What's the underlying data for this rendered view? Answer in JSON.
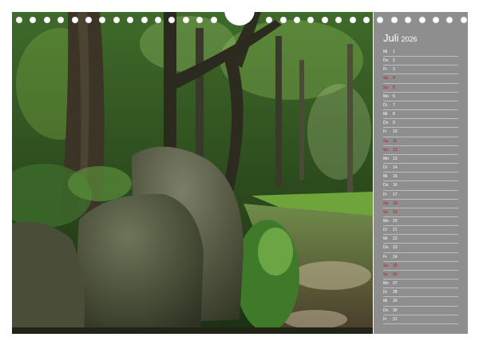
{
  "calendar": {
    "month": "Juli",
    "year": "2026",
    "days": [
      {
        "wd": "Mi",
        "d": "1",
        "we": false
      },
      {
        "wd": "Do",
        "d": "2",
        "we": false
      },
      {
        "wd": "Fr",
        "d": "3",
        "we": false
      },
      {
        "wd": "Sa",
        "d": "4",
        "we": true
      },
      {
        "wd": "So",
        "d": "5",
        "we": true
      },
      {
        "wd": "Mo",
        "d": "6",
        "we": false
      },
      {
        "wd": "Di",
        "d": "7",
        "we": false
      },
      {
        "wd": "Mi",
        "d": "8",
        "we": false
      },
      {
        "wd": "Do",
        "d": "9",
        "we": false
      },
      {
        "wd": "Fr",
        "d": "10",
        "we": false
      },
      {
        "wd": "Sa",
        "d": "11",
        "we": true
      },
      {
        "wd": "So",
        "d": "12",
        "we": true
      },
      {
        "wd": "Mo",
        "d": "13",
        "we": false
      },
      {
        "wd": "Di",
        "d": "14",
        "we": false
      },
      {
        "wd": "Mi",
        "d": "15",
        "we": false
      },
      {
        "wd": "Do",
        "d": "16",
        "we": false
      },
      {
        "wd": "Fr",
        "d": "17",
        "we": false
      },
      {
        "wd": "Sa",
        "d": "18",
        "we": true
      },
      {
        "wd": "So",
        "d": "19",
        "we": true
      },
      {
        "wd": "Mo",
        "d": "20",
        "we": false
      },
      {
        "wd": "Di",
        "d": "21",
        "we": false
      },
      {
        "wd": "Mi",
        "d": "22",
        "we": false
      },
      {
        "wd": "Do",
        "d": "23",
        "we": false
      },
      {
        "wd": "Fr",
        "d": "24",
        "we": false
      },
      {
        "wd": "Sa",
        "d": "25",
        "we": true
      },
      {
        "wd": "So",
        "d": "26",
        "we": true
      },
      {
        "wd": "Mo",
        "d": "27",
        "we": false
      },
      {
        "wd": "Di",
        "d": "28",
        "we": false
      },
      {
        "wd": "Mi",
        "d": "29",
        "we": false
      },
      {
        "wd": "Do",
        "d": "30",
        "we": false
      },
      {
        "wd": "Fr",
        "d": "31",
        "we": false
      }
    ]
  },
  "colors": {
    "panel": "#8e8e8e",
    "weekend": "#c0151b",
    "text": "#ffffff"
  }
}
